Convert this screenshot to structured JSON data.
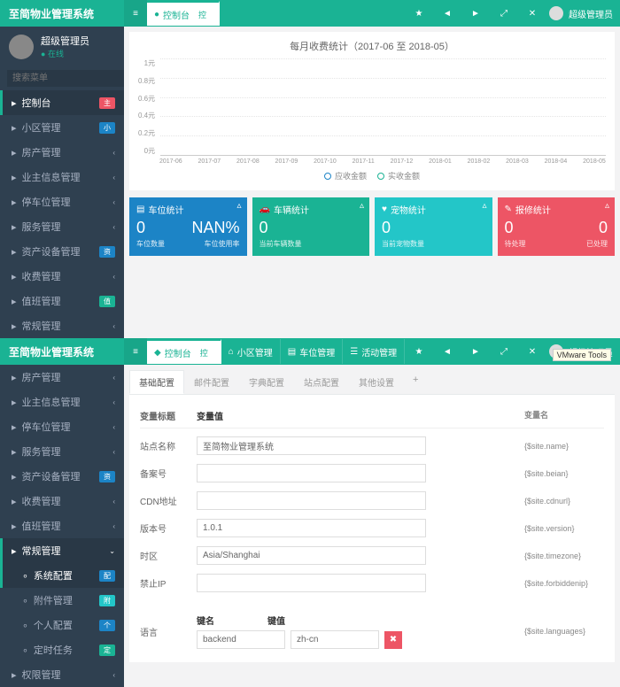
{
  "app_title": "至简物业管理系统",
  "user": {
    "name": "超级管理员",
    "status": "在线"
  },
  "search_placeholder": "搜索菜单",
  "top": {
    "tabs": [
      {
        "label": "控制台",
        "icon": "●"
      }
    ],
    "pill": "控",
    "admin_label": "超级管理员"
  },
  "menu_top": [
    {
      "label": "控制台",
      "badge": "主",
      "badge_cls": "b-red",
      "active": true
    },
    {
      "label": "小区管理",
      "badge": "小",
      "badge_cls": "b-blue"
    },
    {
      "label": "房产管理"
    },
    {
      "label": "业主信息管理"
    },
    {
      "label": "停车位管理"
    },
    {
      "label": "服务管理"
    },
    {
      "label": "资产设备管理",
      "badge": "资",
      "badge_cls": "b-blue"
    },
    {
      "label": "收费管理"
    },
    {
      "label": "值班管理",
      "badge": "值",
      "badge_cls": "b-teal"
    },
    {
      "label": "常规管理"
    }
  ],
  "chart": {
    "title": "每月收费统计（2017-06 至 2018-05）",
    "yticks": [
      "1元",
      "0.8元",
      "0.6元",
      "0.4元",
      "0.2元",
      "0元"
    ],
    "xticks": [
      "2017-06",
      "2017-07",
      "2017-08",
      "2017-09",
      "2017-10",
      "2017-11",
      "2017-12",
      "2018-01",
      "2018-02",
      "2018-03",
      "2018-04",
      "2018-05"
    ],
    "legend": [
      {
        "label": "应收金额",
        "color": "#1c84c6"
      },
      {
        "label": "实收金额",
        "color": "#1ab394"
      }
    ]
  },
  "chart_data": {
    "type": "line",
    "title": "每月收费统计（2017-06 至 2018-05）",
    "xlabel": "",
    "ylabel": "元",
    "ylim": [
      0,
      1
    ],
    "categories": [
      "2017-06",
      "2017-07",
      "2017-08",
      "2017-09",
      "2017-10",
      "2017-11",
      "2017-12",
      "2018-01",
      "2018-02",
      "2018-03",
      "2018-04",
      "2018-05"
    ],
    "series": [
      {
        "name": "应收金额",
        "values": [
          0,
          0,
          0,
          0,
          0,
          0,
          0,
          0,
          0,
          0,
          0,
          0
        ]
      },
      {
        "name": "实收金额",
        "values": [
          0,
          0,
          0,
          0,
          0,
          0,
          0,
          0,
          0,
          0,
          0,
          0
        ]
      }
    ]
  },
  "stats": [
    {
      "cls": "s-blue",
      "icon": "▤",
      "title": "车位统计",
      "v1": "0",
      "v2": "NAN%",
      "f1": "车位数量",
      "f2": "车位使用率"
    },
    {
      "cls": "s-teal",
      "icon": "🚗",
      "title": "车辆统计",
      "v1": "0",
      "v2": "",
      "f1": "当前车辆数量",
      "f2": ""
    },
    {
      "cls": "s-dblue",
      "icon": "♥",
      "title": "宠物统计",
      "v1": "0",
      "v2": "",
      "f1": "当前宠物数量",
      "f2": ""
    },
    {
      "cls": "s-red",
      "icon": "✎",
      "title": "报修统计",
      "v1": "0",
      "v2": "0",
      "f1": "待处理",
      "f2": "已处理"
    }
  ],
  "tooltip": "VMware Tools",
  "bottom": {
    "tabs": [
      {
        "label": "控制台",
        "icon": "◆"
      },
      {
        "label": "小区管理",
        "icon": "⌂"
      },
      {
        "label": "车位管理",
        "icon": "▤"
      },
      {
        "label": "活动管理",
        "icon": "☰"
      }
    ],
    "menu": [
      {
        "label": "房产管理"
      },
      {
        "label": "业主信息管理"
      },
      {
        "label": "停车位管理"
      },
      {
        "label": "服务管理"
      },
      {
        "label": "资产设备管理",
        "badge": "资",
        "badge_cls": "b-blue"
      },
      {
        "label": "收费管理"
      },
      {
        "label": "值班管理"
      },
      {
        "label": "常规管理",
        "active": true,
        "expand": true
      },
      {
        "label": "系统配置",
        "sub": true,
        "badge": "配",
        "badge_cls": "b-blue",
        "active": true
      },
      {
        "label": "附件管理",
        "sub": true,
        "badge": "附",
        "badge_cls": "b-navy"
      },
      {
        "label": "个人配置",
        "sub": true,
        "badge": "个",
        "badge_cls": "b-blue"
      },
      {
        "label": "定时任务",
        "sub": true,
        "badge": "定",
        "badge_cls": "b-teal"
      },
      {
        "label": "权限管理"
      }
    ],
    "form_tabs": [
      "基础配置",
      "邮件配置",
      "字典配置",
      "站点配置",
      "其他设置"
    ],
    "form_tabs_plus": "+",
    "headers": {
      "name": "变量标题",
      "value": "变量值",
      "var": "变量名"
    },
    "fields": [
      {
        "label": "站点名称",
        "value": "至简物业管理系统",
        "var": "{$site.name}"
      },
      {
        "label": "备案号",
        "value": "",
        "var": "{$site.beian}"
      },
      {
        "label": "CDN地址",
        "value": "",
        "var": "{$site.cdnurl}"
      },
      {
        "label": "版本号",
        "value": "1.0.1",
        "var": "{$site.version}"
      },
      {
        "label": "时区",
        "value": "Asia/Shanghai",
        "var": "{$site.timezone}"
      },
      {
        "label": "禁止IP",
        "value": "",
        "var": "{$site.forbiddenip}"
      }
    ],
    "lang": {
      "label": "语言",
      "kh": "键名",
      "vh": "键值",
      "key": "backend",
      "val": "zh-cn",
      "var": "{$site.languages}"
    }
  }
}
